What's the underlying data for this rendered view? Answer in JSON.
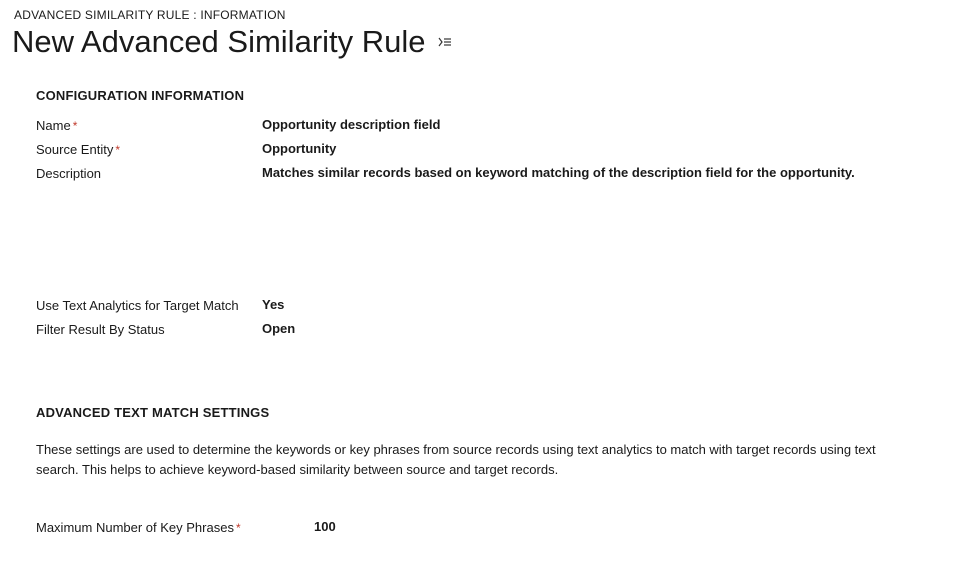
{
  "breadcrumb": "ADVANCED SIMILARITY RULE : INFORMATION",
  "title": "New Advanced Similarity Rule",
  "configSection": {
    "heading": "CONFIGURATION INFORMATION",
    "nameLabel": "Name",
    "nameValue": "Opportunity description field",
    "sourceEntityLabel": "Source Entity",
    "sourceEntityValue": "Opportunity",
    "descriptionLabel": "Description",
    "descriptionValue": "Matches similar records based on keyword matching of the description field for the opportunity.",
    "textAnalyticsLabel": "Use Text Analytics for Target Match",
    "textAnalyticsValue": "Yes",
    "filterStatusLabel": "Filter Result By Status",
    "filterStatusValue": "Open"
  },
  "advancedSection": {
    "heading": "ADVANCED TEXT MATCH SETTINGS",
    "description": "These settings are used to determine the keywords or key phrases from source records using text analytics to match with target records using text search. This helps to achieve keyword-based similarity between source and target records.",
    "maxPhrasesLabel": "Maximum Number of Key Phrases",
    "maxPhrasesValue": "100"
  },
  "requiredMark": "*"
}
